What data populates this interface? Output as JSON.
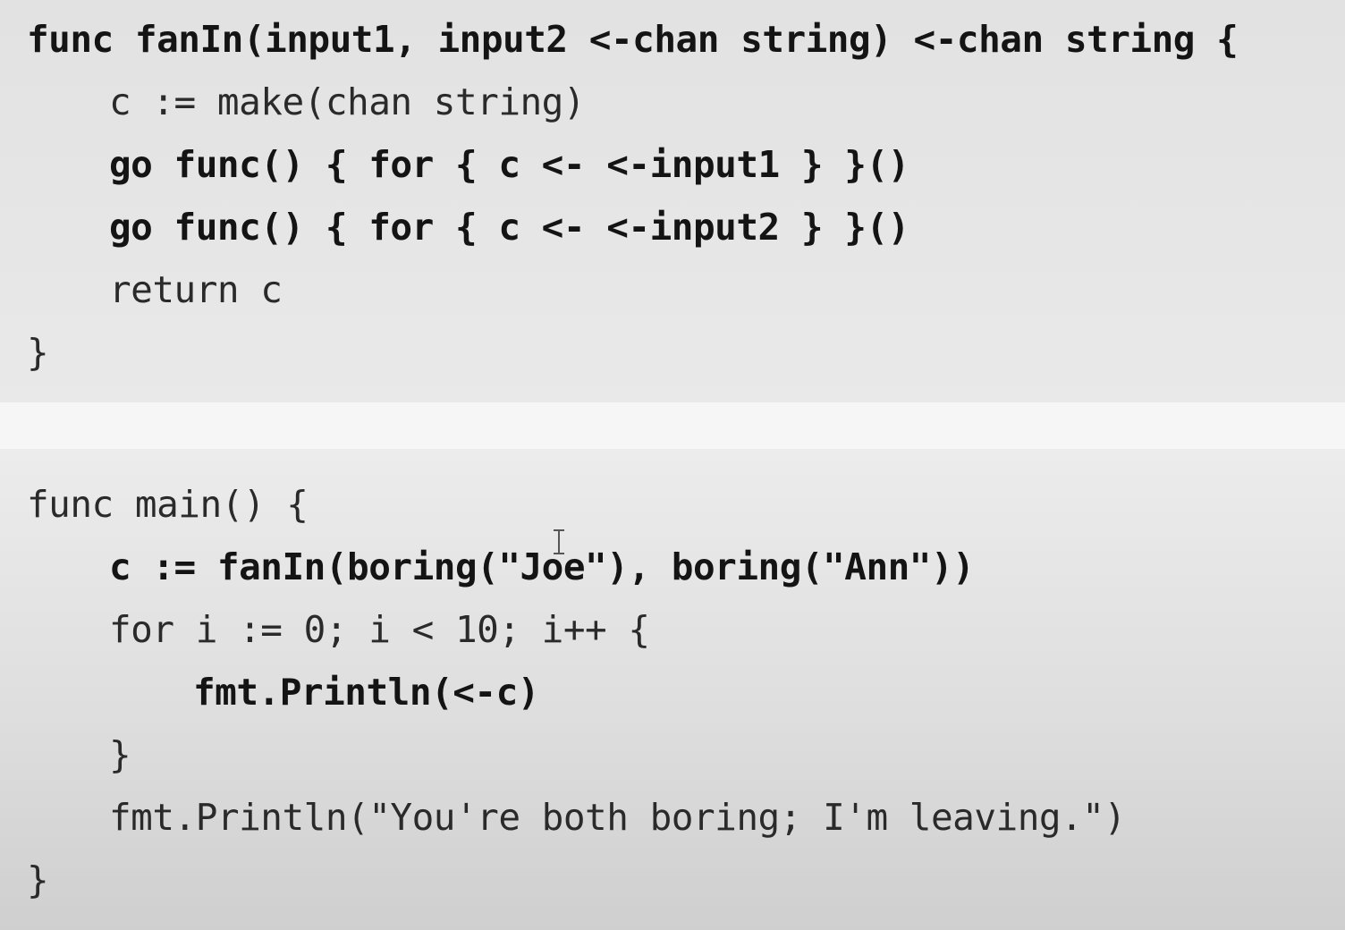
{
  "fanin_block": {
    "lines": [
      "func fanIn(input1, input2 <-chan string) <-chan string {",
      "c := make(chan string)",
      "go func() { for { c <- <-input1 } }()",
      "go func() { for { c <- <-input2 } }()",
      "return c",
      "}"
    ]
  },
  "main_block": {
    "lines": [
      "func main() {",
      "c := fanIn(boring(\"Joe\"), boring(\"Ann\"))",
      "for i := 0; i < 10; i++ {",
      "fmt.Println(<-c)",
      "}",
      "fmt.Println(\"You're both boring; I'm leaving.\")",
      "}"
    ]
  },
  "cursor_icon": "text-cursor-icon"
}
